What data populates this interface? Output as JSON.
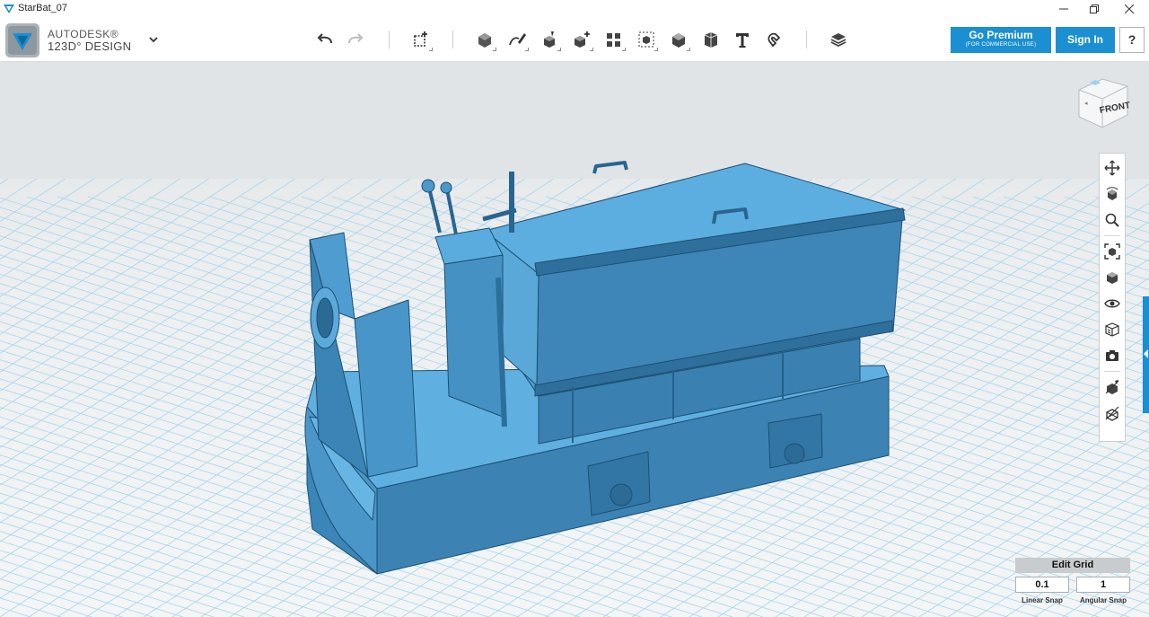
{
  "window": {
    "title": "StarBat_07",
    "controls": [
      "minimize",
      "maximize",
      "close"
    ]
  },
  "app": {
    "logo_line1": "AUTODESK®",
    "logo_line2": "123D° DESIGN"
  },
  "toolbar": {
    "groups": [
      [
        "undo-icon",
        "redo-icon"
      ],
      [
        "transform-icon"
      ],
      [
        "primitives-icon",
        "sketch-icon",
        "construct-icon",
        "modify-icon",
        "pattern-icon",
        "grouping-icon",
        "combine-icon",
        "measure-icon",
        "text-icon",
        "snap-icon"
      ],
      [
        "material-icon"
      ]
    ]
  },
  "account": {
    "premium_label": "Go Premium",
    "premium_sub": "(FOR COMMERCIAL USE)",
    "signin_label": "Sign In",
    "help_label": "?"
  },
  "viewcube": {
    "face_label": "FRONT"
  },
  "navbar": {
    "items": [
      "pan-icon",
      "orbit-icon",
      "zoom-icon",
      "fit-icon",
      "views-icon",
      "visibility-icon",
      "material-display-icon",
      "screenshot-icon",
      "sketch-visibility-icon",
      "mesh-visibility-icon"
    ]
  },
  "grid": {
    "edit_label": "Edit Grid",
    "linear_value": "0.1",
    "angular_value": "1",
    "linear_label": "Linear Snap",
    "angular_label": "Angular Snap"
  },
  "colors": {
    "accent": "#1a8fd1",
    "model_light": "#5aa9da",
    "model_mid": "#3f8bbd",
    "model_dark": "#2d6d98",
    "grid_line": "#9fd1ea",
    "viewport_bg": "#e8ebed"
  }
}
